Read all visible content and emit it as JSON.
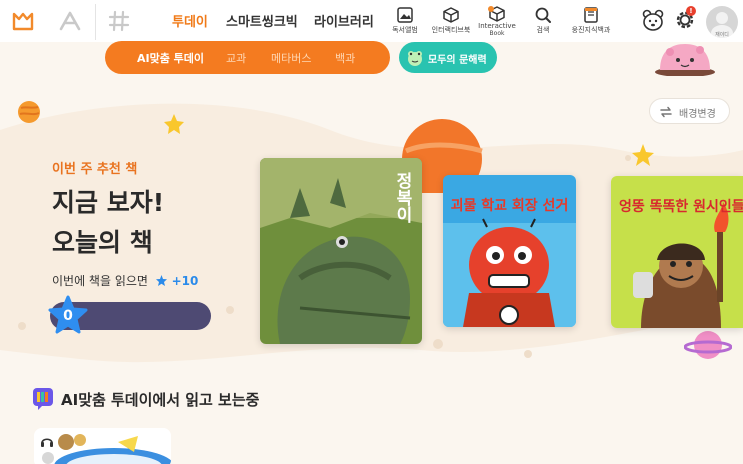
{
  "nav": {
    "main": [
      {
        "label": "투데이",
        "active": true
      },
      {
        "label": "스마트씽크빅",
        "active": false
      },
      {
        "label": "라이브러리",
        "active": false
      }
    ],
    "tools": {
      "album": "독서앨범",
      "interactive_kr": "인터랙티브북",
      "interactive_en_1": "Interactive",
      "interactive_en_2": "Book",
      "search": "검색",
      "encyclopedia": "웅진지식백과"
    },
    "notification_badge": "!",
    "avatar_name": "재이디"
  },
  "subnav": {
    "items": [
      {
        "label": "AI맞춤 투데이",
        "active": true
      },
      {
        "label": "교과",
        "active": false
      },
      {
        "label": "메타버스",
        "active": false
      },
      {
        "label": "백과",
        "active": false
      }
    ]
  },
  "literacy_button": "모두의 문해력",
  "bg_change_button": "배경변경",
  "hero": {
    "subtitle": "이번 주 추천 책",
    "title_line1": "지금 보자!",
    "title_line2": "오늘의 책",
    "reward_text": "이번에 책을 읽으면",
    "reward_points": "+10",
    "progress_fraction": 0.0,
    "star_count": "0"
  },
  "books": [
    {
      "title": "정복이"
    },
    {
      "title": "괴물 학교 회장 선거"
    },
    {
      "title": "엉뚱 똑똑한 원시인들"
    }
  ],
  "section": {
    "title": "AI맞춤 투데이에서 읽고 보는중"
  },
  "colors": {
    "accent": "#f47b20",
    "teal": "#29c3b0",
    "background": "#fbf6ef",
    "progress_track": "#4e4a73"
  }
}
